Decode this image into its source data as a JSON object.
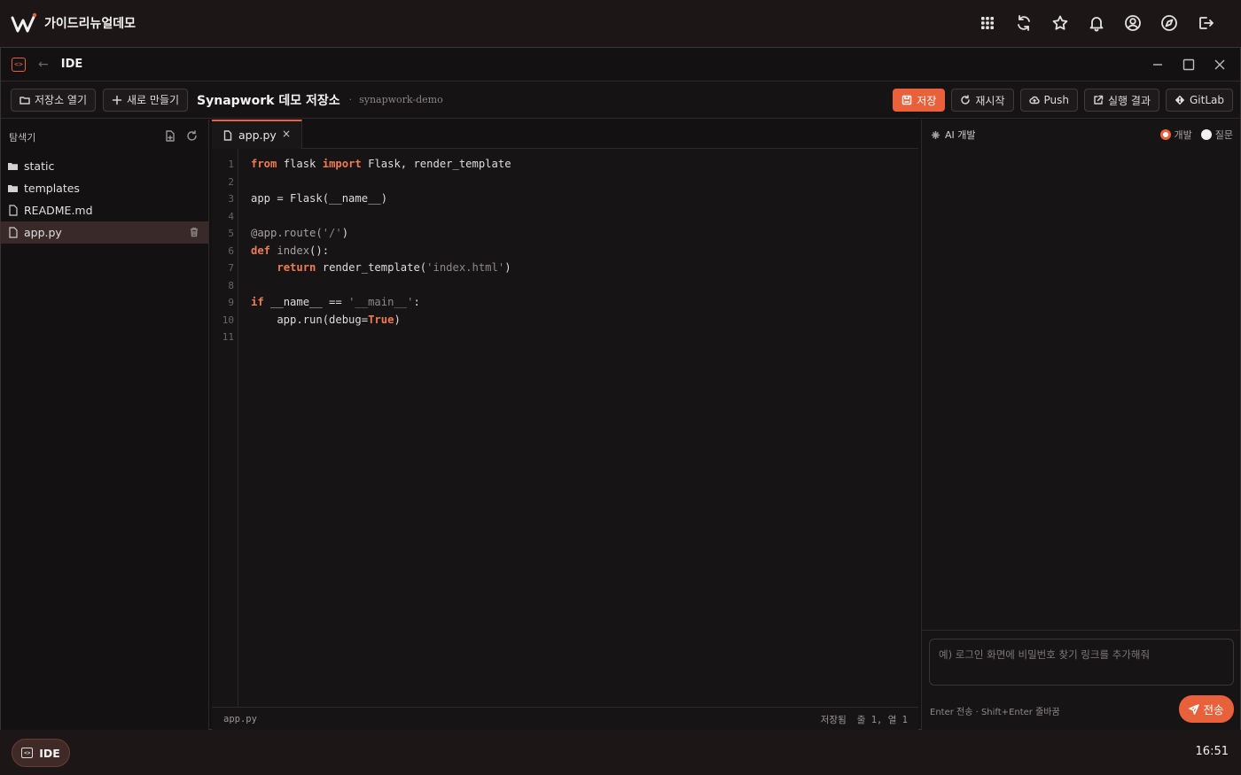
{
  "app": {
    "brand_name": "가이드리뉴얼데모"
  },
  "window": {
    "title": "IDE"
  },
  "toolbar": {
    "open_repo": "저장소 열기",
    "new_create": "새로 만들기",
    "repo_title": "Synapwork 데모 저장소",
    "repo_separator": "·",
    "repo_slug": "synapwork-demo",
    "save": "저장",
    "restart": "재시작",
    "push": "Push",
    "run_result": "실행 결과",
    "gitlab": "GitLab"
  },
  "explorer": {
    "title": "탐색기",
    "items": [
      {
        "name": "static",
        "type": "folder"
      },
      {
        "name": "templates",
        "type": "folder"
      },
      {
        "name": "README.md",
        "type": "file"
      },
      {
        "name": "app.py",
        "type": "file",
        "active": true
      }
    ]
  },
  "editor": {
    "tab_label": "app.py",
    "tab_close": "×",
    "line_numbers": [
      "1",
      "2",
      "3",
      "4",
      "5",
      "6",
      "7",
      "8",
      "9",
      "10",
      "11"
    ],
    "code_lines": [
      [
        {
          "t": "from",
          "c": "kw"
        },
        {
          "t": " flask "
        },
        {
          "t": "import",
          "c": "kw"
        },
        {
          "t": " Flask, render_template"
        }
      ],
      [],
      [
        {
          "t": "app = Flask(__name__)"
        }
      ],
      [],
      [
        {
          "t": "@app.route(",
          "c": "dec"
        },
        {
          "t": "'/'",
          "c": "str"
        },
        {
          "t": ")"
        }
      ],
      [
        {
          "t": "def",
          "c": "kw"
        },
        {
          "t": " "
        },
        {
          "t": "index",
          "c": "dec"
        },
        {
          "t": "():"
        }
      ],
      [
        {
          "t": "    "
        },
        {
          "t": "return",
          "c": "kw"
        },
        {
          "t": " render_template("
        },
        {
          "t": "'index.html'",
          "c": "str"
        },
        {
          "t": ")"
        }
      ],
      [],
      [
        {
          "t": "if",
          "c": "kw"
        },
        {
          "t": " __name__ == "
        },
        {
          "t": "'__main__'",
          "c": "str"
        },
        {
          "t": ":"
        }
      ],
      [
        {
          "t": "    app.run(debug="
        },
        {
          "t": "True",
          "c": "kw"
        },
        {
          "t": ")"
        }
      ],
      []
    ],
    "status_file": "app.py",
    "status_saved": "저장됨",
    "status_position": "줄 1, 열 1"
  },
  "ai": {
    "title": "AI 개발",
    "mode_dev": "개발",
    "mode_ask": "질문",
    "input_placeholder": "예) 로그인 화면에 비밀번호 찾기 링크를 추가해줘",
    "hint": "Enter 전송 · Shift+Enter 줄바꿈",
    "send": "전송"
  },
  "taskbar": {
    "ide_label": "IDE",
    "clock": "16:51"
  },
  "colors": {
    "accent": "#e8613a",
    "background": "#131112",
    "active_row": "#3a2929"
  }
}
